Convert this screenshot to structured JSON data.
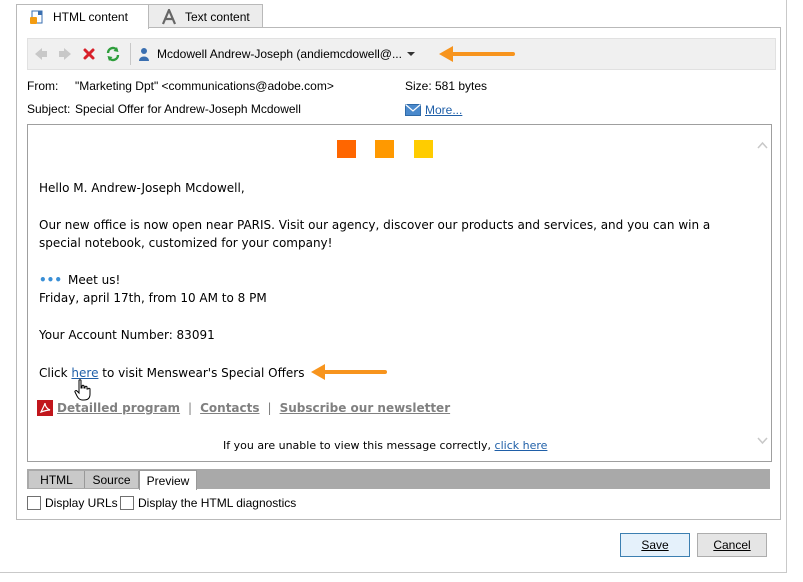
{
  "tabs": [
    {
      "label": "HTML content",
      "icon": "html-doc-icon",
      "active": true
    },
    {
      "label": "Text content",
      "icon": "text-letter-icon",
      "active": false
    }
  ],
  "toolbar": {
    "back_icon": "arrow-left-icon",
    "forward_icon": "arrow-right-icon",
    "delete_icon": "red-x-icon",
    "refresh_icon": "refresh-icon",
    "recipient": "Mcdowell Andrew-Joseph (andiemcdowell@..."
  },
  "header": {
    "from_label": "From:",
    "from_value": "\"Marketing Dpt\" <communications@adobe.com>",
    "size_label": "Size:",
    "size_value": "581 bytes",
    "subject_label": "Subject:",
    "subject_value": "Special Offer for Andrew-Joseph Mcdowell",
    "more_label": "More..."
  },
  "preview": {
    "colors": [
      "#ff6600",
      "#ff9900",
      "#ffcc00"
    ],
    "greeting": "Hello M. Andrew-Joseph Mcdowell,",
    "body_line1": "Our new office is now open near PARIS. Visit our agency, discover our products and services, and you can win a",
    "body_line2": "special notebook, customized for your company!",
    "meet_dots": "•••",
    "meet_title": "Meet us!",
    "meet_date": "Friday, april 17th, from 10 AM to 8 PM",
    "account": "Your Account Number: 83091",
    "click_prefix": "Click ",
    "click_link": "here",
    "click_suffix": " to visit Menswear's Special Offers",
    "link_program": "Detailled program",
    "sep": "|",
    "link_contacts": "Contacts",
    "link_newsletter": "Subscribe our newsletter",
    "footer_text": "If you are unable to view this message correctly,",
    "footer_link": "click here"
  },
  "bottom_tabs": [
    {
      "label": "HTML",
      "active": false
    },
    {
      "label": "Source",
      "active": false
    },
    {
      "label": "Preview",
      "active": true
    }
  ],
  "options": {
    "display_urls": "Display URLs",
    "display_diagnostics": "Display the HTML diagnostics"
  },
  "buttons": {
    "save": "Save",
    "cancel": "Cancel"
  },
  "accent": "#f7941d"
}
